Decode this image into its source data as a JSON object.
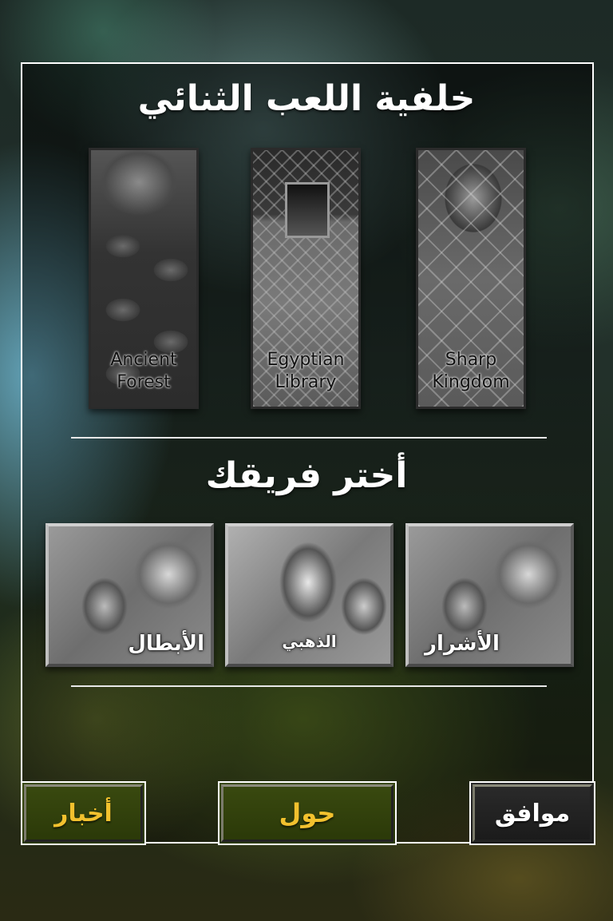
{
  "screen": {
    "background_title": "خلفية اللعب الثنائي",
    "team_title": "أختر فريقك"
  },
  "backgrounds": [
    {
      "line1": "Ancient",
      "line2": "Forest"
    },
    {
      "line1": "Egyptian",
      "line2": "Library"
    },
    {
      "line1": "Sharp",
      "line2": "Kingdom"
    }
  ],
  "teams": [
    {
      "label": "الأبطال"
    },
    {
      "label": "الذهبي"
    },
    {
      "label": "الأشرار"
    }
  ],
  "buttons": {
    "news": "أخبار",
    "about": "حول",
    "ok": "موافق"
  },
  "colors": {
    "accent_gold": "#f2c12e",
    "button_green": "#3a4a10",
    "panel_border": "#ffffff"
  }
}
